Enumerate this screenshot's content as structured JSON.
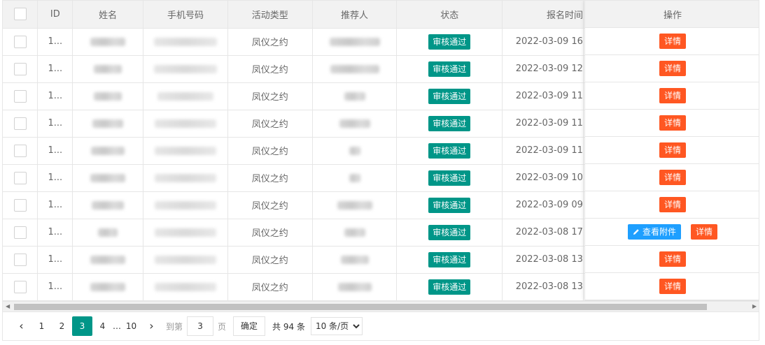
{
  "table": {
    "headers": [
      "ID",
      "姓名",
      "手机号码",
      "活动类型",
      "推荐人",
      "状态",
      "报名时间"
    ],
    "action_header": "操作",
    "rows": [
      {
        "id": "1...",
        "name": "",
        "phone": "",
        "activity": "凤仪之约",
        "referrer": "",
        "status": "审核通过",
        "time": "2022-03-09 16",
        "name_w": 50,
        "phone_w": 90,
        "ref_w": 72,
        "has_attach": false
      },
      {
        "id": "1...",
        "name": "",
        "phone": "",
        "activity": "凤仪之约",
        "referrer": "",
        "status": "审核通过",
        "time": "2022-03-09 12",
        "name_w": 40,
        "phone_w": 90,
        "ref_w": 70,
        "has_attach": false
      },
      {
        "id": "1...",
        "name": "",
        "phone": "",
        "activity": "凤仪之约",
        "referrer": "",
        "status": "审核通过",
        "time": "2022-03-09 11",
        "name_w": 40,
        "phone_w": 80,
        "ref_w": 30,
        "has_attach": false
      },
      {
        "id": "1...",
        "name": "",
        "phone": "",
        "activity": "凤仪之约",
        "referrer": "",
        "status": "审核通过",
        "time": "2022-03-09 11",
        "name_w": 44,
        "phone_w": 88,
        "ref_w": 44,
        "has_attach": false
      },
      {
        "id": "1...",
        "name": "",
        "phone": "",
        "activity": "凤仪之约",
        "referrer": "",
        "status": "审核通过",
        "time": "2022-03-09 11",
        "name_w": 48,
        "phone_w": 88,
        "ref_w": 16,
        "has_attach": false
      },
      {
        "id": "1...",
        "name": "",
        "phone": "",
        "activity": "凤仪之约",
        "referrer": "",
        "status": "审核通过",
        "time": "2022-03-09 10",
        "name_w": 50,
        "phone_w": 88,
        "ref_w": 16,
        "has_attach": false
      },
      {
        "id": "1...",
        "name": "",
        "phone": "",
        "activity": "凤仪之约",
        "referrer": "",
        "status": "审核通过",
        "time": "2022-03-09 09",
        "name_w": 46,
        "phone_w": 88,
        "ref_w": 50,
        "has_attach": false
      },
      {
        "id": "1...",
        "name": "",
        "phone": "",
        "activity": "凤仪之约",
        "referrer": "",
        "status": "审核通过",
        "time": "2022-03-08 17",
        "name_w": 28,
        "phone_w": 88,
        "ref_w": 30,
        "has_attach": true
      },
      {
        "id": "1...",
        "name": "",
        "phone": "",
        "activity": "凤仪之约",
        "referrer": "",
        "status": "审核通过",
        "time": "2022-03-08 13",
        "name_w": 50,
        "phone_w": 88,
        "ref_w": 40,
        "has_attach": false
      },
      {
        "id": "1...",
        "name": "",
        "phone": "",
        "activity": "凤仪之约",
        "referrer": "",
        "status": "审核通过",
        "time": "2022-03-08 13",
        "name_w": 50,
        "phone_w": 88,
        "ref_w": 48,
        "has_attach": false
      }
    ],
    "detail_label": "详情",
    "attach_label": "查看附件"
  },
  "pager": {
    "prev_icon": "‹",
    "next_icon": "›",
    "pages": [
      "1",
      "2",
      "3",
      "4"
    ],
    "current": "3",
    "ellipsis": "…",
    "last": "10",
    "goto_label": "到第",
    "goto_value": "3",
    "page_unit": "页",
    "confirm_label": "确定",
    "total_text": "共 94 条",
    "page_size": "10 条/页",
    "page_size_options": [
      "10 条/页"
    ]
  },
  "colors": {
    "status": "#009688",
    "detail": "#ff5722",
    "attach": "#1e9fff",
    "active_page": "#009688"
  }
}
